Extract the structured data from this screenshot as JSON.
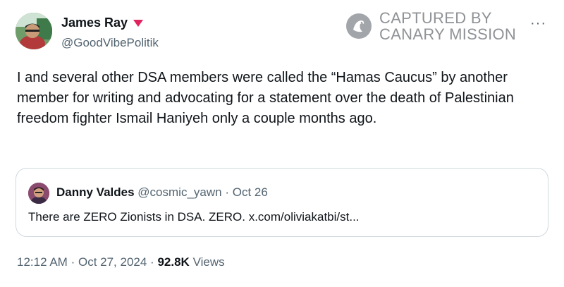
{
  "author": {
    "display_name": "James Ray",
    "handle": "@GoodVibePolitik"
  },
  "watermark": {
    "line1": "CAPTURED BY",
    "line2": "CANARY MISSION"
  },
  "more_label": "···",
  "tweet_text": "I and several other DSA members were called the “Hamas Caucus” by another member for writing and advocating for a statement over the death of Palestinian freedom fighter Ismail Haniyeh only a couple months ago.",
  "quoted": {
    "display_name": "Danny Valdes",
    "handle": "@cosmic_yawn",
    "separator": "·",
    "date": "Oct 26",
    "text": "There are ZERO Zionists in DSA. ZERO. x.com/oliviakatbi/st..."
  },
  "footer": {
    "time": "12:12 AM",
    "separator": "·",
    "date": "Oct 27, 2024",
    "views_count": "92.8K",
    "views_label": "Views"
  },
  "colors": {
    "text": "#0f1419",
    "muted": "#536471",
    "border": "#cfd9de",
    "watermark": "#8f9296",
    "badge": "#e0245e"
  }
}
